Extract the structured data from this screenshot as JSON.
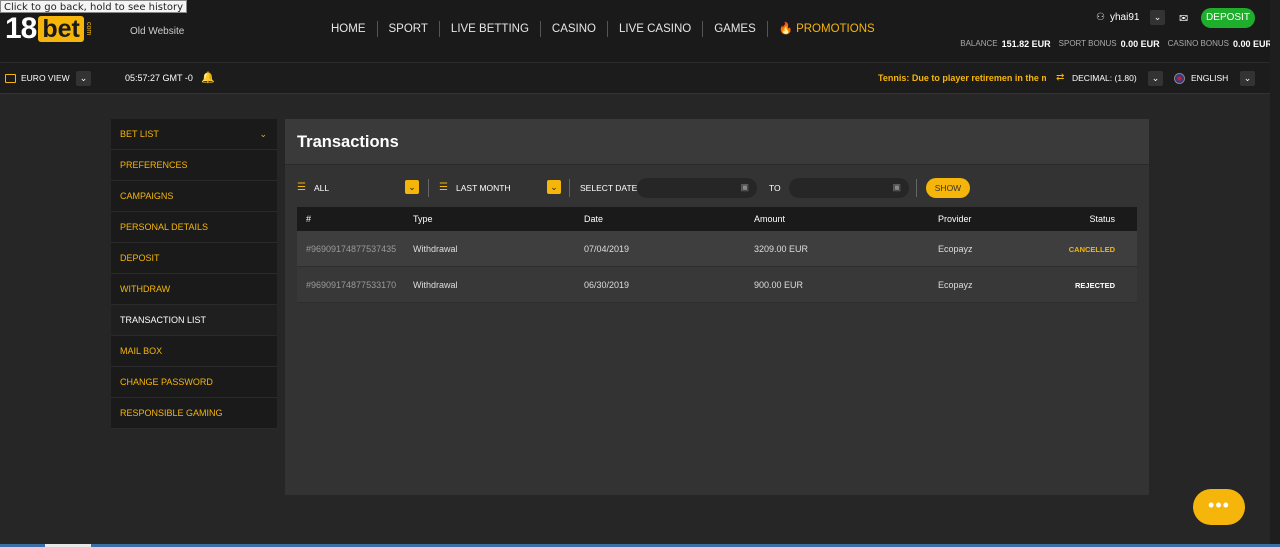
{
  "tooltip": "Click to go back, hold to see history",
  "logo": {
    "num": "18",
    "bet": "bet",
    "com": "com"
  },
  "header": {
    "old_website": "Old Website",
    "nav": [
      "HOME",
      "SPORT",
      "LIVE BETTING",
      "CASINO",
      "LIVE CASINO",
      "GAMES"
    ],
    "promotions": "PROMOTIONS",
    "username": "yhai91",
    "deposit": "DEPOSIT",
    "balance_label": "BALANCE",
    "balance_value": "151.82 EUR",
    "sport_bonus_label": "SPORT BONUS",
    "sport_bonus_value": "0.00 EUR",
    "casino_bonus_label": "CASINO BONUS",
    "casino_bonus_value": "0.00 EUR"
  },
  "subbar": {
    "euro_view": "EURO VIEW",
    "clock": "05:57:27 GMT -0",
    "ticker": "Tennis: Due to player retiremen in the m",
    "odds_format": "DECIMAL: (1.80)",
    "language": "ENGLISH"
  },
  "sidebar": {
    "items": [
      {
        "label": "BET LIST"
      },
      {
        "label": "PREFERENCES"
      },
      {
        "label": "CAMPAIGNS"
      },
      {
        "label": "PERSONAL DETAILS"
      },
      {
        "label": "DEPOSIT"
      },
      {
        "label": "WITHDRAW"
      },
      {
        "label": "TRANSACTION LIST"
      },
      {
        "label": "MAIL BOX"
      },
      {
        "label": "CHANGE PASSWORD"
      },
      {
        "label": "RESPONSIBLE GAMING"
      }
    ],
    "active_index": 6
  },
  "main": {
    "title": "Transactions",
    "filters": {
      "type_value": "ALL",
      "period_value": "LAST MONTH",
      "select_date_label": "SELECT DATE",
      "from_value": "",
      "to_label": "TO",
      "to_value": "",
      "show_button": "SHOW"
    },
    "table": {
      "headers": [
        "#",
        "Type",
        "Date",
        "Amount",
        "Provider",
        "Status"
      ],
      "rows": [
        {
          "id": "#96909174877537435",
          "type": "Withdrawal",
          "date": "07/04/2019",
          "amount": "3209.00 EUR",
          "provider": "Ecopayz",
          "status": "CANCELLED"
        },
        {
          "id": "#96909174877533170",
          "type": "Withdrawal",
          "date": "06/30/2019",
          "amount": "900.00 EUR",
          "provider": "Ecopayz",
          "status": "REJECTED"
        }
      ]
    }
  },
  "chat": {
    "label": "•••"
  },
  "colors": {
    "accent": "#f5b50b",
    "deposit_green": "#1fae2b",
    "background": "#262626",
    "panel": "#333333"
  }
}
